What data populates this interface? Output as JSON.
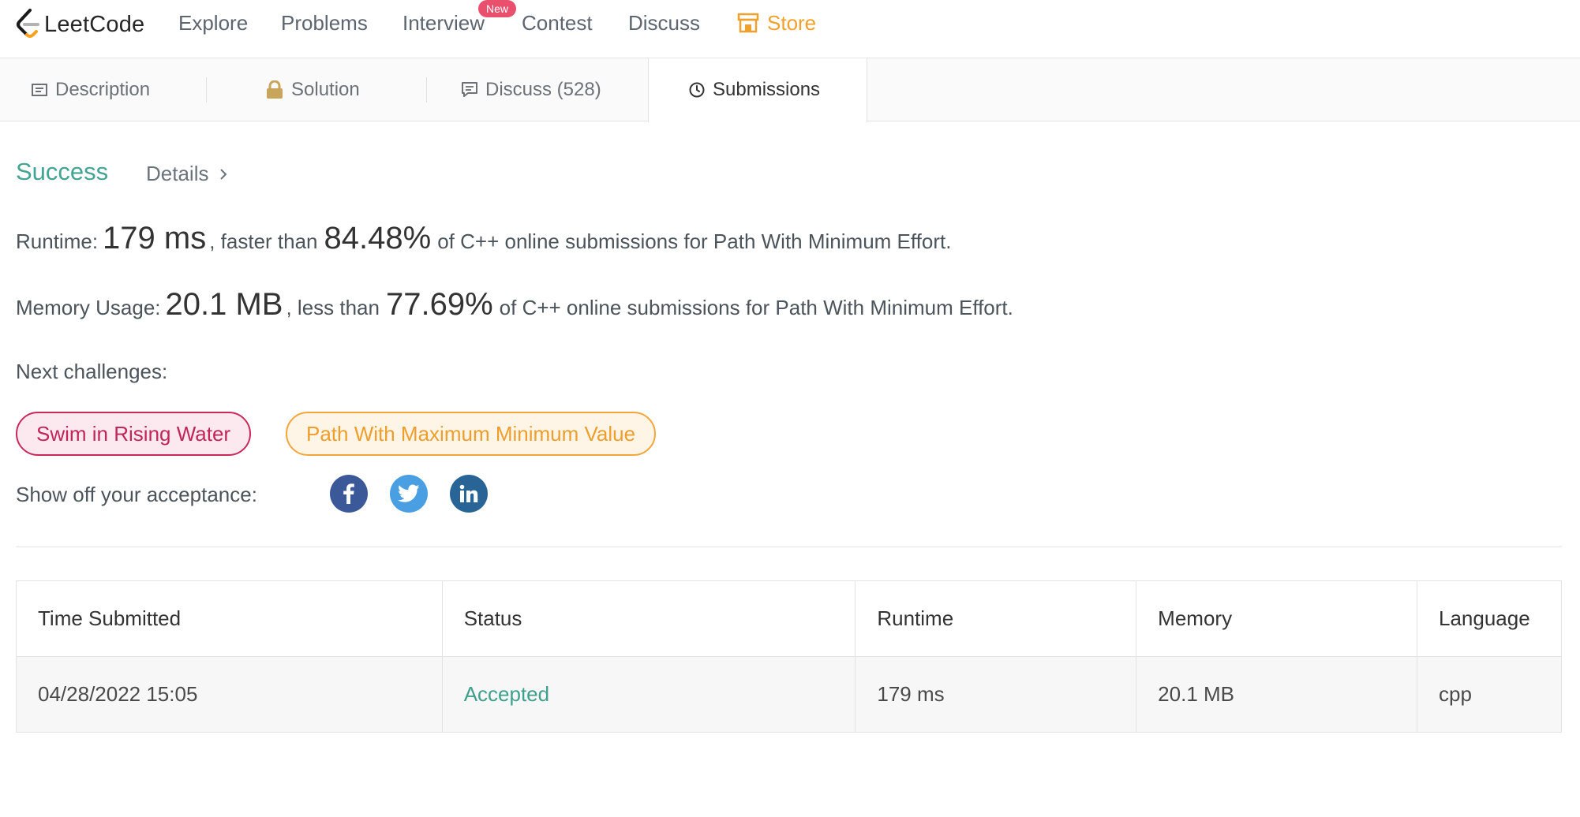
{
  "nav": {
    "logo_text": "LeetCode",
    "items": [
      "Explore",
      "Problems",
      "Interview",
      "Contest",
      "Discuss"
    ],
    "new_badge": "New",
    "store": "Store"
  },
  "tabs": [
    {
      "label": "Description"
    },
    {
      "label": "Solution"
    },
    {
      "label": "Discuss (528)"
    },
    {
      "label": "Submissions"
    }
  ],
  "result": {
    "status": "Success",
    "details": "Details",
    "runtime": {
      "prefix": "Runtime:",
      "value": "179 ms",
      "mid": ", faster than",
      "percent": "84.48%",
      "suffix": "of C++ online submissions for Path With Minimum Effort."
    },
    "memory": {
      "prefix": "Memory Usage:",
      "value": "20.1 MB",
      "mid": ", less than",
      "percent": "77.69%",
      "suffix": "of C++ online submissions for Path With Minimum Effort."
    },
    "next_label": "Next challenges:",
    "challenges": [
      "Swim in Rising Water",
      "Path With Maximum Minimum Value"
    ],
    "share_label": "Show off your acceptance:"
  },
  "colors": {
    "success": "#42a593",
    "store": "#f0a12c",
    "facebook": "#3b5998",
    "twitter": "#4a9fe3",
    "linkedin": "#296496"
  },
  "table": {
    "headers": [
      "Time Submitted",
      "Status",
      "Runtime",
      "Memory",
      "Language"
    ],
    "rows": [
      [
        "04/28/2022 15:05",
        "Accepted",
        "179 ms",
        "20.1 MB",
        "cpp"
      ]
    ]
  }
}
